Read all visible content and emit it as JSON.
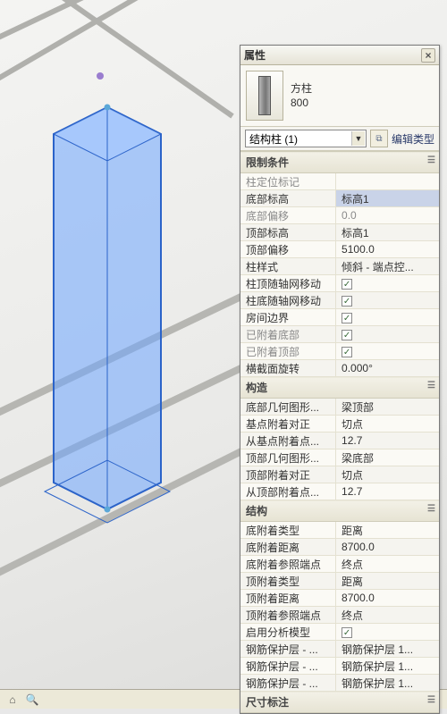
{
  "palette": {
    "title": "属性",
    "family_name": "方柱",
    "type_name": "800",
    "selector": "结构柱 (1)",
    "edit_type": "编辑类型"
  },
  "groups": [
    {
      "name": "限制条件",
      "rows": [
        {
          "label": "柱定位标记",
          "value": "",
          "ro": true
        },
        {
          "label": "底部标高",
          "value": "标高1",
          "sel": true
        },
        {
          "label": "底部偏移",
          "value": "0.0",
          "ro": true
        },
        {
          "label": "顶部标高",
          "value": "标高1"
        },
        {
          "label": "顶部偏移",
          "value": "5100.0"
        },
        {
          "label": "柱样式",
          "value": "倾斜 - 端点控..."
        },
        {
          "label": "柱顶随轴网移动",
          "check": true
        },
        {
          "label": "柱底随轴网移动",
          "check": true
        },
        {
          "label": "房间边界",
          "check": true
        },
        {
          "label": "已附着底部",
          "check": true,
          "ro": true
        },
        {
          "label": "已附着顶部",
          "check": true,
          "ro": true
        },
        {
          "label": "横截面旋转",
          "value": "0.000°"
        }
      ]
    },
    {
      "name": "构造",
      "rows": [
        {
          "label": "底部几何图形...",
          "value": "梁顶部"
        },
        {
          "label": "基点附着对正",
          "value": "切点"
        },
        {
          "label": "从基点附着点...",
          "value": "12.7"
        },
        {
          "label": "顶部几何图形...",
          "value": "梁底部"
        },
        {
          "label": "顶部附着对正",
          "value": "切点"
        },
        {
          "label": "从顶部附着点...",
          "value": "12.7"
        }
      ]
    },
    {
      "name": "结构",
      "rows": [
        {
          "label": "底附着类型",
          "value": "距离"
        },
        {
          "label": "底附着距离",
          "value": "8700.0"
        },
        {
          "label": "底附着参照端点",
          "value": "终点"
        },
        {
          "label": "顶附着类型",
          "value": "距离"
        },
        {
          "label": "顶附着距离",
          "value": "8700.0"
        },
        {
          "label": "顶附着参照端点",
          "value": "终点"
        },
        {
          "label": "启用分析模型",
          "check": true
        },
        {
          "label": "钢筋保护层 - ...",
          "value": "钢筋保护层 1..."
        },
        {
          "label": "钢筋保护层 - ...",
          "value": "钢筋保护层 1..."
        },
        {
          "label": "钢筋保护层 - ...",
          "value": "钢筋保护层 1..."
        }
      ]
    },
    {
      "name": "尺寸标注",
      "rows": []
    }
  ],
  "status": {
    "coords": ""
  }
}
